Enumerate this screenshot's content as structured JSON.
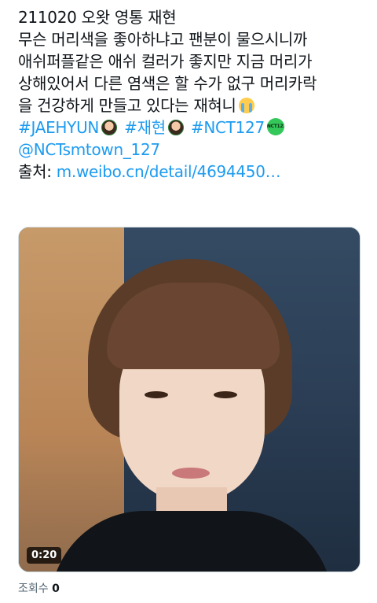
{
  "tweet": {
    "line1": "211020 오왓 영통 재현",
    "line2": "무슨 머리색을 좋아하냐고 팬분이 물으시니까",
    "line3": "애쉬퍼플같은 애쉬 컬러가 좋지만 지금 머리가",
    "line4": "상해있어서 다른 염색은 할 수가 없구 머리카락",
    "line5": "을 건강하게 만들고 있다는 재혀니",
    "hashtag1": "#JAEHYUN",
    "hashtag2": "#재현",
    "hashtag3": "#NCT127",
    "logo_text": "NCT127",
    "mention": "@NCTsmtown_127",
    "source_label": "출처: ",
    "source_link": "m.weibo.cn/detail/4694450…"
  },
  "media": {
    "timestamp": "0:20"
  },
  "stats": {
    "views_label": "조회수",
    "views_count": "0"
  },
  "icons": {
    "cry": "loudly-crying-face-icon",
    "face": "jaehyun-emoji-icon",
    "logo": "nct127-logo-icon"
  },
  "colors": {
    "link": "#1d9bf0",
    "text": "#0f1419",
    "muted": "#536471"
  }
}
